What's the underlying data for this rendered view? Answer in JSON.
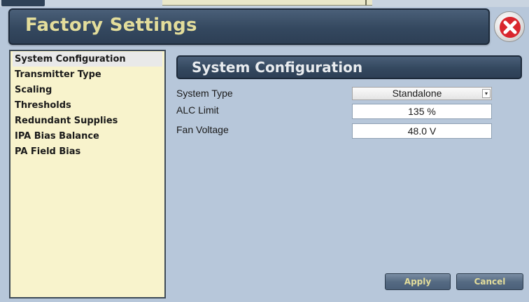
{
  "window": {
    "title": "Factory Settings",
    "close_icon": "close-x-icon"
  },
  "sidebar": {
    "items": [
      {
        "label": "System Configuration",
        "selected": true
      },
      {
        "label": "Transmitter Type",
        "selected": false
      },
      {
        "label": "Scaling",
        "selected": false
      },
      {
        "label": "Thresholds",
        "selected": false
      },
      {
        "label": "Redundant Supplies",
        "selected": false
      },
      {
        "label": "IPA Bias Balance",
        "selected": false
      },
      {
        "label": "PA Field Bias",
        "selected": false
      }
    ]
  },
  "main": {
    "section_title": "System Configuration",
    "fields": {
      "system_type": {
        "label": "System Type",
        "value": "Standalone"
      },
      "alc_limit": {
        "label": "ALC Limit",
        "value": "135 %"
      },
      "fan_voltage": {
        "label": "Fan Voltage",
        "value": "48.0 V"
      }
    },
    "buttons": {
      "apply": "Apply",
      "cancel": "Cancel"
    }
  },
  "colors": {
    "title_text": "#e3dd9b",
    "panel_dark": "#34485f",
    "background": "#b7c7da",
    "list_background": "#f8f3cc",
    "close_red": "#d9262d"
  }
}
